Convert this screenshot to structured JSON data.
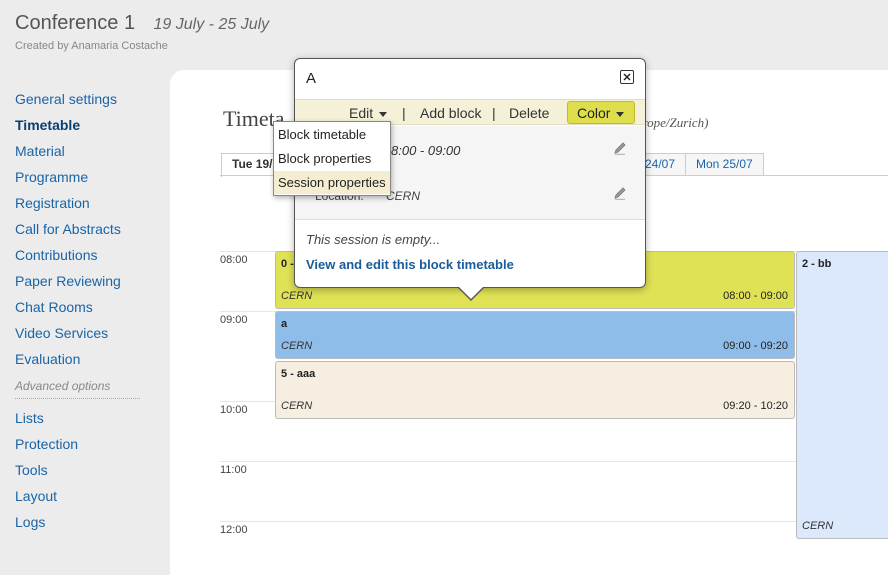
{
  "conference": {
    "title": "Conference 1",
    "dates": "19 July - 25 July",
    "created_by": "Created by Anamaria Costache"
  },
  "sidebar": {
    "items": [
      {
        "label": "General settings"
      },
      {
        "label": "Timetable"
      },
      {
        "label": "Material"
      },
      {
        "label": "Programme"
      },
      {
        "label": "Registration"
      },
      {
        "label": "Call for Abstracts"
      },
      {
        "label": "Contributions"
      },
      {
        "label": "Paper Reviewing"
      },
      {
        "label": "Chat Rooms"
      },
      {
        "label": "Video Services"
      },
      {
        "label": "Evaluation"
      }
    ],
    "advanced_label": "Advanced options",
    "advanced_items": [
      {
        "label": "Lists"
      },
      {
        "label": "Protection"
      },
      {
        "label": "Tools"
      },
      {
        "label": "Layout"
      },
      {
        "label": "Logs"
      }
    ]
  },
  "timetable": {
    "title": "Timeta",
    "timezone": "urope/Zurich)",
    "tabs": [
      "Tue 19/",
      "24/07",
      "Mon 25/07"
    ],
    "hours": [
      "08:00",
      "09:00",
      "10:00",
      "11:00",
      "12:00"
    ],
    "blocks": [
      {
        "title": "0 -",
        "location": "CERN",
        "time": "08:00 - 09:00",
        "color": "#e0e256"
      },
      {
        "title": "a",
        "location": "CERN",
        "time": "09:00 - 09:20",
        "color": "#8fbde9"
      },
      {
        "title": "5 - aaa",
        "location": "CERN",
        "time": "09:20 - 10:20",
        "color": "#f7eee2"
      },
      {
        "title": "2 - bb",
        "location": "CERN",
        "time": "",
        "color": "#dce8fb"
      }
    ]
  },
  "popup": {
    "title": "A",
    "toolbar": {
      "edit": "Edit",
      "add_block": "Add block",
      "delete": "Delete",
      "color": "Color",
      "separator": "|"
    },
    "info": {
      "time": "8:00 - 09:00",
      "location_label": "Location:",
      "location": "CERN"
    },
    "empty_text": "This session is empty...",
    "link": "View and edit this block timetable"
  },
  "edit_menu": {
    "items": [
      "Block timetable",
      "Block properties",
      "Session properties"
    ]
  }
}
